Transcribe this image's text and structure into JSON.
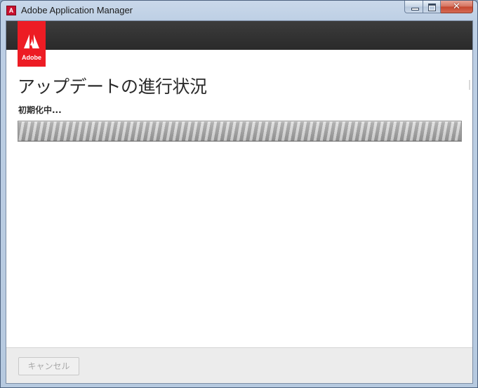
{
  "window": {
    "title": "Adobe Application Manager",
    "controls": {
      "minimize": "minimize",
      "maximize": "maximize",
      "close": "✕"
    }
  },
  "brand": {
    "logo_text": "Adobe",
    "color": "#ed1c24"
  },
  "main": {
    "title": "アップデートの進行状況",
    "status": "初期化中...",
    "progress": {
      "state": "indeterminate"
    }
  },
  "footer": {
    "cancel_label": "キャンセル",
    "cancel_enabled": false
  }
}
